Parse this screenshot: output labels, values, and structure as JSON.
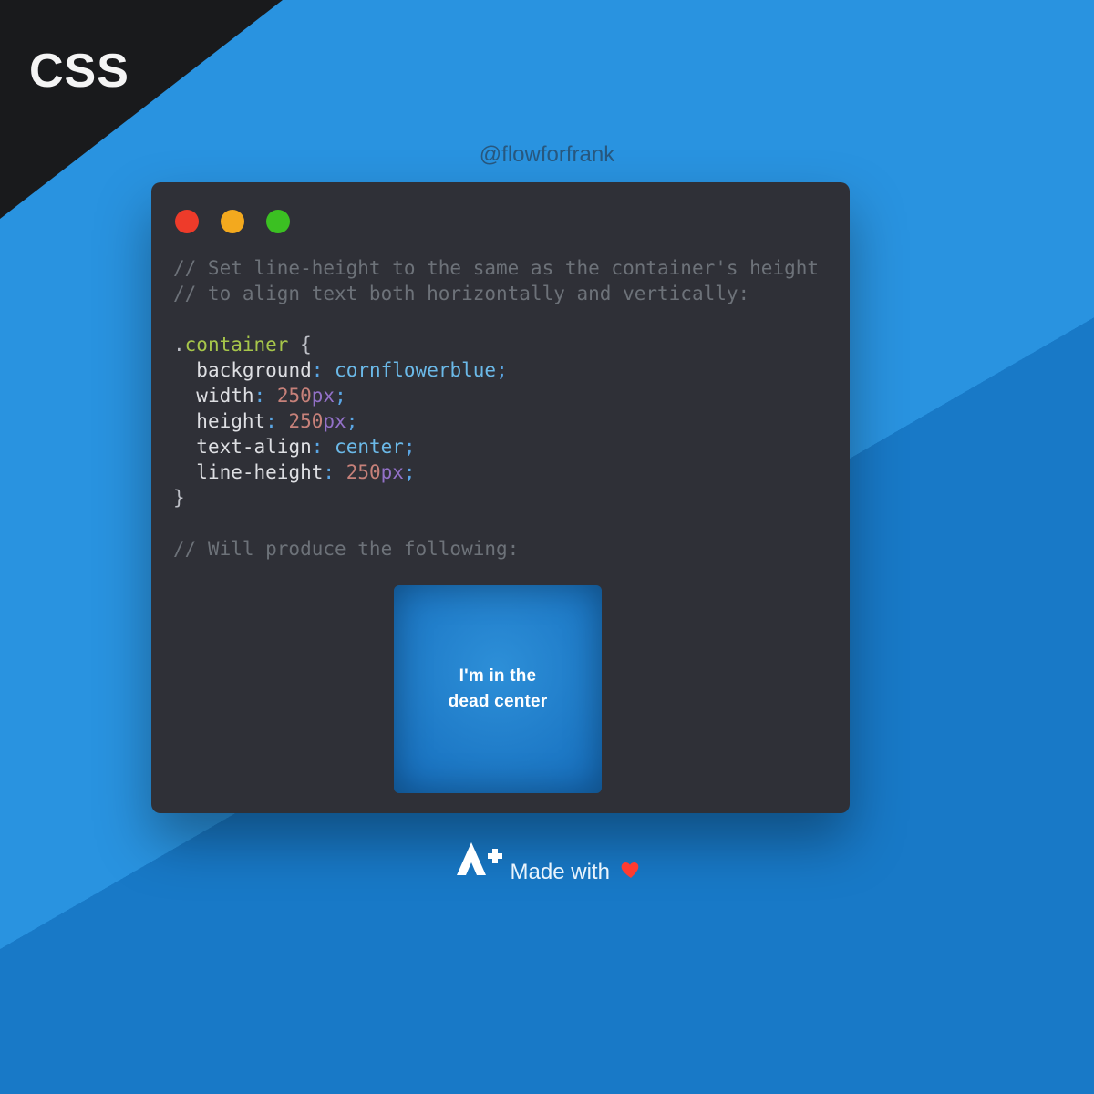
{
  "badge": "CSS",
  "handle": "@flowforfrank",
  "code": {
    "comment1": "// Set line-height to the same as the container's height",
    "comment2": "// to align text both horizontally and vertically:",
    "selector": "container",
    "props": {
      "background_k": "background",
      "background_v": "cornflowerblue",
      "width_k": "width",
      "width_num": "250",
      "width_unit": "px",
      "height_k": "height",
      "height_num": "250",
      "height_unit": "px",
      "textalign_k": "text-align",
      "textalign_v": "center",
      "lineheight_k": "line-height",
      "lineheight_num": "250",
      "lineheight_unit": "px"
    },
    "comment3": "// Will produce the following:"
  },
  "demo": {
    "line1": "I'm in the",
    "line2": "dead center"
  },
  "footer": {
    "madewith": "Made with"
  }
}
